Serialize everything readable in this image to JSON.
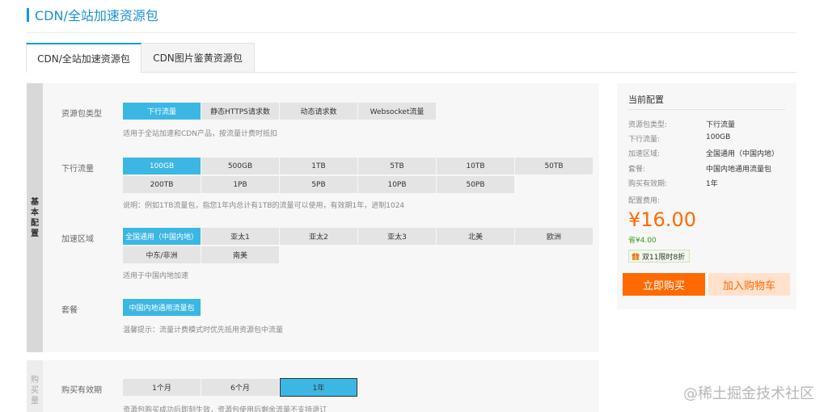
{
  "page": {
    "title": "CDN/全站加速资源包"
  },
  "tabs": [
    {
      "label": "CDN/全站加速资源包"
    },
    {
      "label": "CDN图片鉴黄资源包"
    }
  ],
  "basic": {
    "side_label": [
      "基",
      "本",
      "配",
      "置"
    ],
    "package_type": {
      "label": "资源包类型",
      "options": [
        "下行流量",
        "静态HTTPS请求数",
        "动态请求数",
        "Websocket流量"
      ],
      "selected": "下行流量",
      "hint": "适用于全站加速和CDN产品，按流量计费时抵扣"
    },
    "downstream": {
      "label": "下行流量",
      "options": [
        "100GB",
        "500GB",
        "1TB",
        "5TB",
        "10TB",
        "50TB",
        "200TB",
        "1PB",
        "5PB",
        "10PB",
        "50PB"
      ],
      "selected": "100GB",
      "hint": "说明：例如1TB流量包，指您1年内总计有1TB的流量可以使用，有效期1年，进制1024"
    },
    "region": {
      "label": "加速区域",
      "options": [
        "全国通用（中国内地）",
        "亚太1",
        "亚太2",
        "亚太3",
        "北美",
        "欧洲",
        "中东/非洲",
        "南美"
      ],
      "selected": "全国通用（中国内地）",
      "hint": "适用于中国内地加速"
    },
    "bundle": {
      "label": "套餐",
      "options": [
        "中国内地通用流量包"
      ],
      "selected": "中国内地通用流量包",
      "hint": "温馨提示：流量计费模式时优先抵用资源包中流量"
    }
  },
  "purchase": {
    "side_label": [
      "购",
      "买",
      "量"
    ],
    "validity": {
      "label": "购买有效期",
      "options": [
        "1个月",
        "6个月",
        "1年"
      ],
      "selected": "1年",
      "hint": "资源包购买成功后即刻生效，资源包使用后剩余流量不支持退订"
    }
  },
  "config": {
    "title": "当前配置",
    "rows": [
      {
        "key": "资源包类型:",
        "value": "下行流量"
      },
      {
        "key": "下行流量:",
        "value": "100GB"
      },
      {
        "key": "加速区域:",
        "value": "全国通用（中国内地）"
      },
      {
        "key": "套餐:",
        "value": "中国内地通用流量包"
      },
      {
        "key": "购买有效期:",
        "value": "1年"
      }
    ],
    "fee_label": "配置费用:",
    "price": "¥16.00",
    "saving": "省¥4.00",
    "promo": "双11限时8折",
    "buy_now": "立即购买",
    "add_cart": "加入购物车"
  },
  "watermark": "@稀土掘金技术社区",
  "colors": {
    "accent": "#3cb7e3",
    "brand_blue": "#0e9bd8",
    "orange": "#ff6a00",
    "green": "#3a9a1a"
  }
}
